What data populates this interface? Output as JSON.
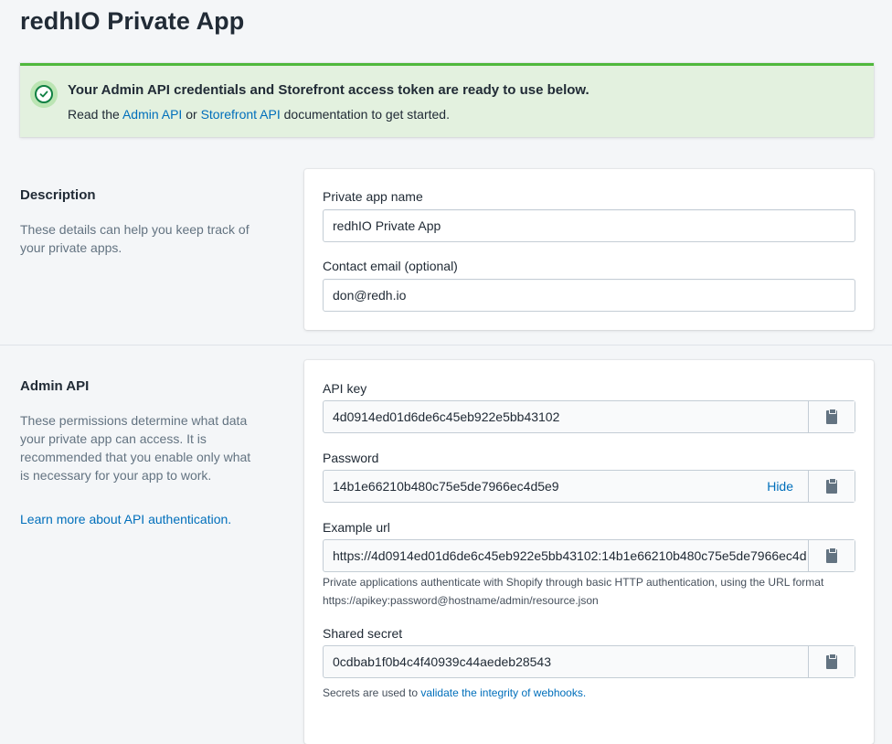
{
  "page": {
    "title": "redhIO Private App"
  },
  "banner": {
    "title": "Your Admin API credentials and Storefront access token are ready to use below.",
    "body_prefix": "Read the",
    "admin_link": "Admin API",
    "or_text": "or",
    "storefront_link": "Storefront API",
    "body_suffix": "documentation to get started."
  },
  "description_section": {
    "title": "Description",
    "text": "These details can help you keep track of your private apps.",
    "app_name_label": "Private app name",
    "app_name_value": "redhIO Private App",
    "email_label": "Contact email (optional)",
    "email_value": "don@redh.io"
  },
  "admin_api_section": {
    "title": "Admin API",
    "text": "These permissions determine what data your private app can access. It is recommended that you enable only what is necessary for your app to work.",
    "learn_more_link": "Learn more about API authentication.",
    "api_key_label": "API key",
    "api_key_value": "4d0914ed01d6de6c45eb922e5bb43102",
    "password_label": "Password",
    "password_value": "14b1e66210b480c75e5de7966ec4d5e9",
    "hide_label": "Hide",
    "example_url_label": "Example url",
    "example_url_value": "https://4d0914ed01d6de6c45eb922e5bb43102:14b1e66210b480c75e5de7966ec4d",
    "example_url_help_line1": "Private applications authenticate with Shopify through basic HTTP authentication, using the URL format",
    "example_url_help_line2": "https://apikey:password@hostname/admin/resource.json",
    "shared_secret_label": "Shared secret",
    "shared_secret_value": "0cdbab1f0b4c4f40939c44aedeb28543",
    "secret_help_prefix": "Secrets are used to",
    "secret_help_link": "validate the integrity of webhooks."
  },
  "icons": {
    "success": "checkmark-circle-icon",
    "copy": "clipboard-icon"
  },
  "colors": {
    "success_bg": "#e3f1df",
    "success_border": "#50b83c",
    "link": "#006fbb"
  }
}
